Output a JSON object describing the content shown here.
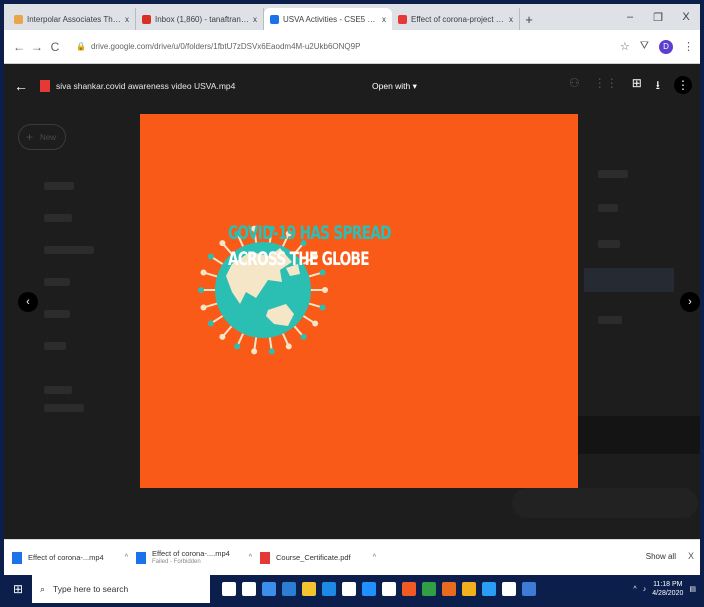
{
  "browser": {
    "tabs": [
      {
        "title": "Interpolar Associates Thenwho",
        "favicon_color": "#e8a54b",
        "active": false
      },
      {
        "title": "Inbox (1,860) - tanaftranoi@b",
        "favicon_color": "#d93025",
        "active": false
      },
      {
        "title": "USVA Activities - CSE5 Dep",
        "favicon_color": "#1a73e8",
        "active": true
      },
      {
        "title": "Effect of corona-project copy",
        "favicon_color": "#e53935",
        "active": false
      }
    ],
    "tab_close": "x",
    "new_tab": "+",
    "window_controls": [
      "–",
      "❐",
      "X"
    ],
    "nav": {
      "back": "←",
      "forward": "→",
      "reload": "C"
    },
    "url": "drive.google.com/drive/u/0/folders/1fbtU7zDSVx6Eaodm4M-u2Ukb6ONQ9P",
    "profile_initial": "D"
  },
  "viewer": {
    "file_name": "siva shankar.covid awareness video USVA.mp4",
    "open_with": "Open with ▾",
    "slide": {
      "line1": "COVID-19 HAS SPREAD",
      "line2": "ACROSS THE GLOBE",
      "background": "#fa5a17",
      "accent": "#28c0b7"
    },
    "prev_icon": "‹",
    "next_icon": "›",
    "more_icon": "⋮",
    "download_icon": "⭳",
    "add_icon": "⊞",
    "sidebar_new": "New"
  },
  "downloads": {
    "items": [
      {
        "name": "Effect of corona-...mp4",
        "sub": "",
        "color": "#1a73e8"
      },
      {
        "name": "Effect of corona-....mp4",
        "sub": "Failed - Forbidden",
        "color": "#1a73e8"
      },
      {
        "name": "Course_Certificate.pdf",
        "sub": "",
        "color": "#e53935"
      }
    ],
    "show_all": "Show all",
    "close": "X"
  },
  "taskbar": {
    "search_placeholder": "Type here to search",
    "time": "11:18 PM",
    "date": "4/28/2020",
    "apps": [
      "#ffffff",
      "#ffffff",
      "#3b8eea",
      "#2d7dd2",
      "#f4c430",
      "#1e88e5",
      "#ffffff",
      "#1e90ff",
      "#ffffff",
      "#f15a24",
      "#2f9e44",
      "#e86b1f",
      "#f2b01e",
      "#2a9df4",
      "#ffffff",
      "#3e7bd6"
    ]
  }
}
